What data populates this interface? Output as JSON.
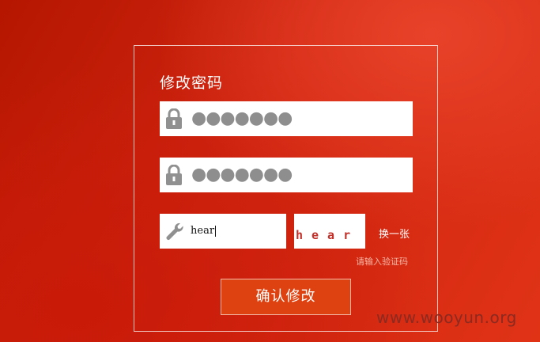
{
  "form": {
    "title": "修改密码",
    "password1": {
      "mask": "●●●●●●●",
      "icon": "lock-icon"
    },
    "password2": {
      "mask": "●●●●●●●",
      "icon": "lock-icon"
    },
    "code": {
      "value": "hear",
      "icon": "wrench-icon"
    },
    "captcha": {
      "text": "hear"
    },
    "refresh_label": "换一张",
    "hint": "请输入验证码",
    "submit_label": "确认修改"
  },
  "watermark": "www.wooyun.org",
  "colors": {
    "accent": "#de4211",
    "background": "#cf2410",
    "captcha_text": "#c2302a"
  }
}
